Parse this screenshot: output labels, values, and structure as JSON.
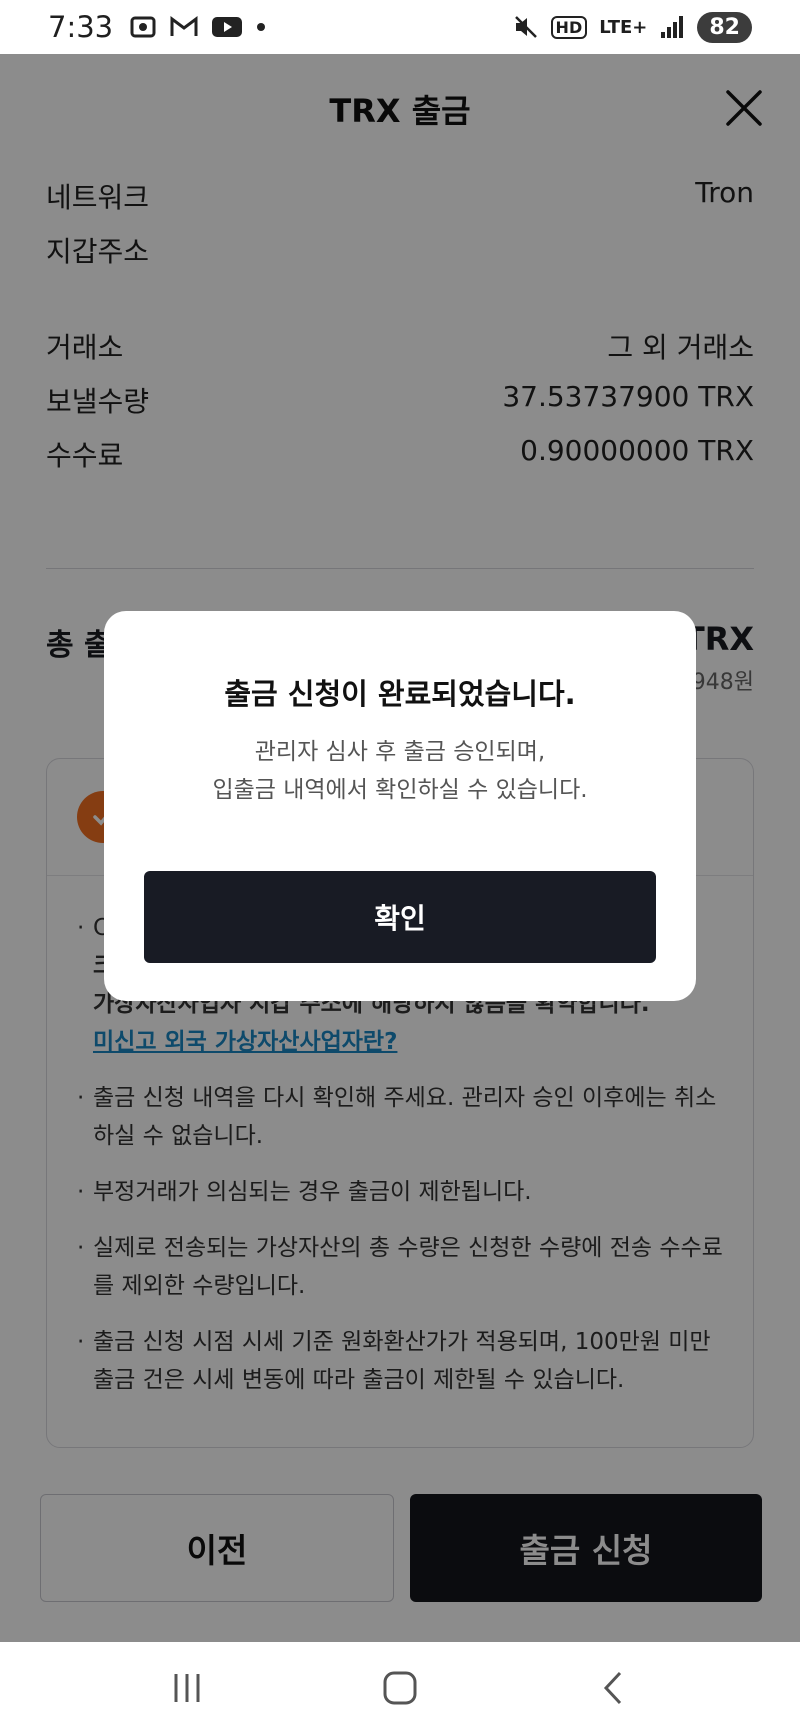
{
  "status_bar": {
    "time": "7:33",
    "battery": "82",
    "network_label": "LTE+",
    "hd_label": "HD"
  },
  "header": {
    "title": "TRX 출금"
  },
  "details": {
    "network_label": "네트워크",
    "network_value": "Tron",
    "wallet_label": "지갑주소",
    "wallet_value": "",
    "exchange_label": "거래소",
    "exchange_value": "그 외 거래소",
    "amount_label": "보낼수량",
    "amount_value": "37.53737900 TRX",
    "fee_label": "수수료",
    "fee_value": "0.90000000 TRX"
  },
  "total": {
    "label": "총 출",
    "value": "TRX",
    "krw": "948원"
  },
  "notice": {
    "items": [
      {
        "text": "C",
        "bold": "크",
        "rest": "가상자산사업자 지갑 주소에 해당하지 않음을 확약합니다.",
        "link": "미신고 외국 가상자산사업자란?"
      },
      {
        "text": "출금 신청 내역을 다시 확인해 주세요. 관리자 승인 이후에는 취소하실 수 없습니다."
      },
      {
        "text": "부정거래가 의심되는 경우 출금이 제한됩니다."
      },
      {
        "text": "실제로 전송되는 가상자산의 총 수량은 신청한 수량에 전송 수수료를 제외한 수량입니다."
      },
      {
        "text": "출금 신청 시점 시세 기준 원화환산가가 적용되며, 100만원 미만 출금 건은 시세 변동에 따라 출금이 제한될 수 있습니다."
      }
    ]
  },
  "buttons": {
    "prev": "이전",
    "submit": "출금 신청"
  },
  "modal": {
    "title": "출금 신청이 완료되었습니다.",
    "line1": "관리자 심사 후 출금 승인되며,",
    "line2": "입출금 내역에서 확인하실 수 있습니다.",
    "confirm": "확인"
  },
  "colors": {
    "accent_dark": "#14161d",
    "check_orange": "#f36f21",
    "link_blue": "#1b87c4"
  }
}
